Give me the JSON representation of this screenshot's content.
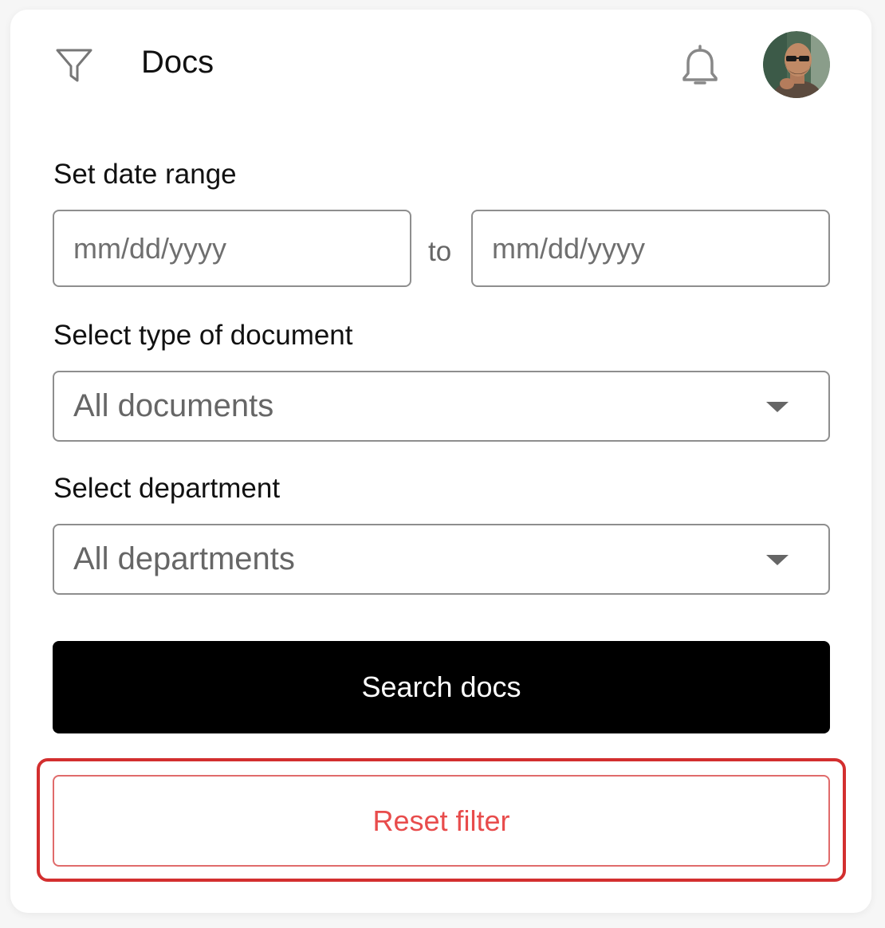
{
  "header": {
    "title": "Docs",
    "filter_icon": "filter-icon",
    "bell_icon": "bell-icon",
    "avatar_icon": "user-avatar"
  },
  "date_range": {
    "label": "Set date range",
    "from_placeholder": "mm/dd/yyyy",
    "separator": "to",
    "to_placeholder": "mm/dd/yyyy"
  },
  "document_type": {
    "label": "Select type of document",
    "selected": "All documents"
  },
  "department": {
    "label": "Select department",
    "selected": "All departments"
  },
  "actions": {
    "search_label": "Search docs",
    "reset_label": "Reset filter"
  },
  "colors": {
    "primary_button": "#000000",
    "reset_text": "#e84c4c",
    "highlight_border": "#d32f2f",
    "field_border": "#8e8e8e"
  }
}
